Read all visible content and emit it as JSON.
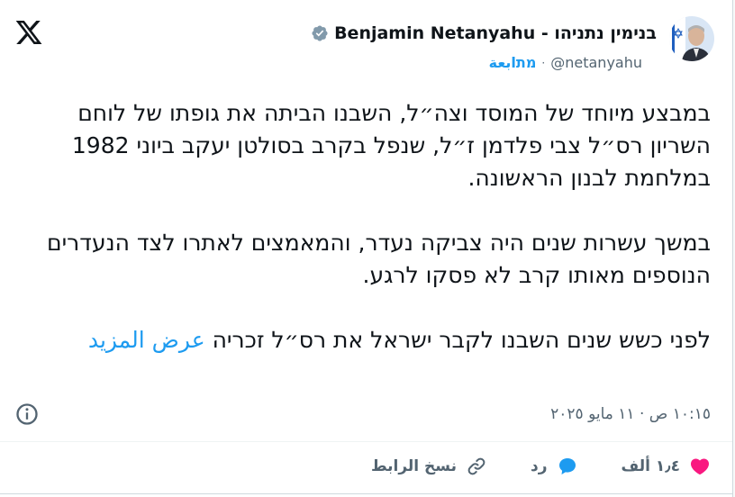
{
  "author": {
    "name": "Benjamin Netanyahu - בנימין נתניהו",
    "handle": "@netanyahu",
    "separator": "·",
    "follow_label": "מתابعة"
  },
  "tweet": {
    "paragraphs": [
      "במבצע מיוחד של המוסד וצה״ל, השבנו הביתה את גופתו של לוחם השריון רס״ל צבי פלדמן ז״ל, שנפל בקרב בסולטן יעקב ביוני 1982 במלחמת לבנון הראשונה.",
      "במשך עשרות שנים היה צביקה נעדר, והמאמצים לאתרו לצד הנעדרים הנוספים מאותו קרב לא פסקו לרגע.",
      "לפני כשש שנים השבנו לקבר ישראל את רס״ל זכריה"
    ],
    "show_more": "عرض المزيد",
    "timestamp": "١٠:١٥ ص · ١١ مايو ٢٠٢٥"
  },
  "actions": {
    "likes": "١٫٤ ألف",
    "reply_label": "رد",
    "copy_link_label": "نسخ الرابط"
  },
  "colors": {
    "accent": "#1d9bf0",
    "like": "#f91880",
    "secondary_text": "#536471"
  }
}
